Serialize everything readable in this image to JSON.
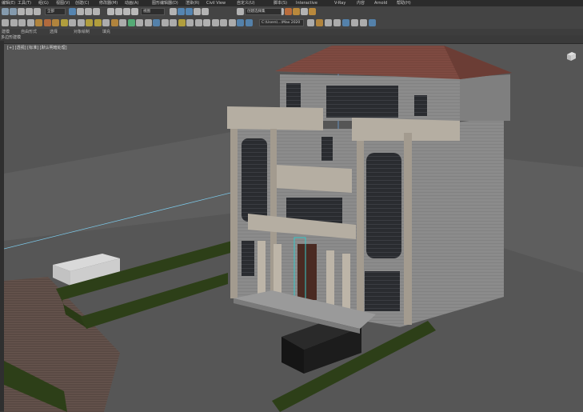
{
  "menu": [
    {
      "label": "编辑(E)"
    },
    {
      "label": "工具(T)"
    },
    {
      "label": "组(G)"
    },
    {
      "label": "视图(V)"
    },
    {
      "label": "创建(C)"
    },
    {
      "label": "修改器(M)"
    },
    {
      "label": "动画(A)"
    },
    {
      "label": "图形编辑器(D)"
    },
    {
      "label": "渲染(R)"
    },
    {
      "label": "Civil View"
    },
    {
      "label": "自定义(U)"
    },
    {
      "label": "脚本(S)"
    },
    {
      "label": "Interactive"
    },
    {
      "label": "V-Ray"
    },
    {
      "label": "内容"
    },
    {
      "label": "Arnold"
    },
    {
      "label": "帮助(H)"
    }
  ],
  "toolbar": {
    "selection_filter": "全部",
    "ref_coord": "视图",
    "named_selection": "创建选择集",
    "path_field": "C:\\Users\\...\\Max 2020"
  },
  "ribbon_tabs": [
    {
      "label": "建模"
    },
    {
      "label": "自由形式"
    },
    {
      "label": "选择"
    },
    {
      "label": "对象绘制"
    },
    {
      "label": "填充"
    }
  ],
  "ribbon_sub": "多边形建模",
  "viewport": {
    "label": "[+] [透视] [标准] [默认明暗处理]"
  },
  "colors": {
    "ui_dark": "#2b2b2b",
    "ui_toolbar": "#444444",
    "viewport_bg": "#555555",
    "roof": "#7e4a41",
    "wall": "#8c8c8c",
    "trim": "#b5aea2",
    "hedge": "#2d3f18",
    "selection": "#35c8c8"
  }
}
